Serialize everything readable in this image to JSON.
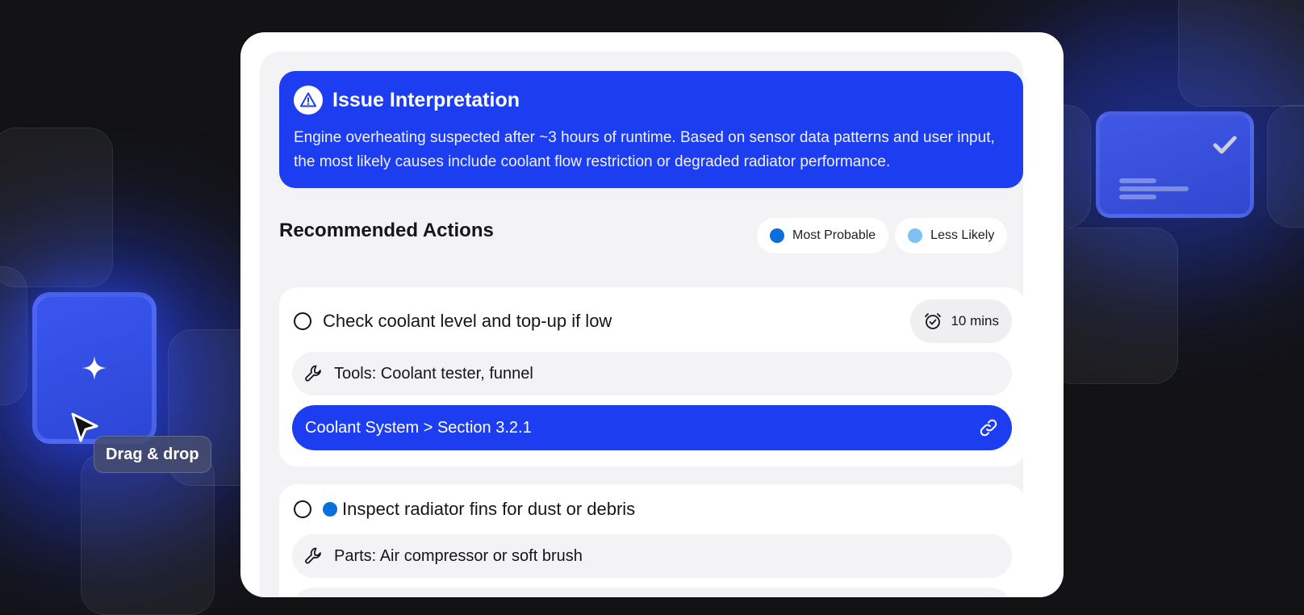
{
  "background": {
    "drag_label": "Drag & drop"
  },
  "issue": {
    "title": "Issue Interpretation",
    "description": "Engine overheating suspected after ~3 hours of runtime. Based on sensor data patterns and user input, the most likely causes include coolant flow restriction or degraded radiator performance.",
    "icon": "warning-icon"
  },
  "recommended": {
    "title": "Recommended Actions",
    "legend": [
      {
        "label": "Most Probable",
        "color": "#0a6fdc"
      },
      {
        "label": "Less Likely",
        "color": "#7ec2f5"
      }
    ]
  },
  "actions": [
    {
      "title": "Check coolant level and top-up if low",
      "time": "10 mins",
      "detail": "Tools: Coolant tester, funnel",
      "link": "Coolant System > Section 3.2.1"
    },
    {
      "title": "Inspect radiator fins for dust or debris",
      "probability_color": "#0a6fdc",
      "detail": "Parts: Air compressor or soft brush"
    }
  ],
  "colors": {
    "accent": "#1c3ef0",
    "background": "#131316",
    "panel": "#f3f3f5"
  }
}
